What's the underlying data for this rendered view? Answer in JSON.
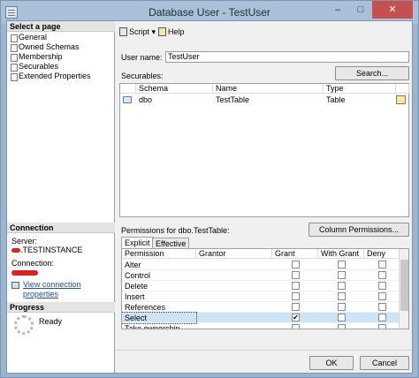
{
  "window": {
    "title": "Database User - TestUser",
    "minimize": "–",
    "maximize": "□",
    "close": "✕"
  },
  "left_panel": {
    "select_page_header": "Select a page",
    "pages": [
      "General",
      "Owned Schemas",
      "Membership",
      "Securables",
      "Extended Properties"
    ],
    "connection_header": "Connection",
    "server_label": "Server:",
    "server_value": ".TESTINSTANCE",
    "connection_label": "Connection:",
    "view_connection_link": "View connection properties",
    "progress_header": "Progress",
    "progress_status": "Ready"
  },
  "toolbar": {
    "script_label": "Script",
    "script_arrow": "▾",
    "help_label": "Help"
  },
  "form": {
    "user_name_label": "User name:",
    "user_name_value": "TestUser",
    "securables_label": "Securables:",
    "search_button": "Search..."
  },
  "securables_grid": {
    "columns": [
      "Schema",
      "Name",
      "Type"
    ],
    "rows": [
      {
        "schema": "dbo",
        "name": "TestTable",
        "type": "Table"
      }
    ]
  },
  "permissions": {
    "label": "Permissions for dbo.TestTable:",
    "column_permissions_button": "Column Permissions...",
    "tabs": [
      "Explicit",
      "Effective"
    ],
    "columns": [
      "Permission",
      "Grantor",
      "Grant",
      "With Grant",
      "Deny"
    ],
    "rows": [
      {
        "permission": "Alter",
        "grantor": "",
        "grant": false,
        "with_grant": false,
        "deny": false,
        "selected": false
      },
      {
        "permission": "Control",
        "grantor": "",
        "grant": false,
        "with_grant": false,
        "deny": false,
        "selected": false
      },
      {
        "permission": "Delete",
        "grantor": "",
        "grant": false,
        "with_grant": false,
        "deny": false,
        "selected": false
      },
      {
        "permission": "Insert",
        "grantor": "",
        "grant": false,
        "with_grant": false,
        "deny": false,
        "selected": false
      },
      {
        "permission": "References",
        "grantor": "",
        "grant": false,
        "with_grant": false,
        "deny": false,
        "selected": false
      },
      {
        "permission": "Select",
        "grantor": "",
        "grant": true,
        "with_grant": false,
        "deny": false,
        "selected": true
      },
      {
        "permission": "Take ownership",
        "grantor": "",
        "grant": false,
        "with_grant": false,
        "deny": false,
        "selected": false
      }
    ]
  },
  "footer": {
    "ok_button": "OK",
    "cancel_button": "Cancel"
  },
  "check_glyph": "✔"
}
